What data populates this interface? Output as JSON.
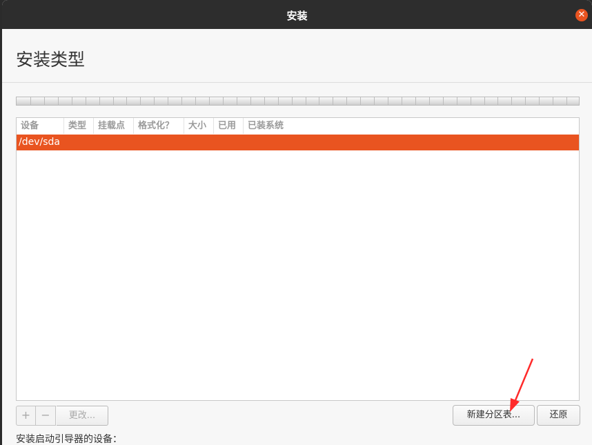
{
  "window": {
    "title": "安装",
    "close_icon": "close-icon"
  },
  "page": {
    "title": "安装类型"
  },
  "table": {
    "columns": [
      "设备",
      "类型",
      "挂载点",
      "格式化？",
      "大小",
      "已用",
      "已装系统"
    ],
    "rows": [
      {
        "device": "/dev/sda",
        "selected": true
      }
    ]
  },
  "toolbar": {
    "add_label": "+",
    "remove_label": "−",
    "change_label": "更改...",
    "new_table_label": "新建分区表...",
    "revert_label": "还原"
  },
  "bootloader": {
    "label": "安装启动引导器的设备："
  },
  "colors": {
    "accent": "#e95420",
    "titlebar": "#2d2d2d",
    "annotation_arrow": "#ff2a2a"
  }
}
